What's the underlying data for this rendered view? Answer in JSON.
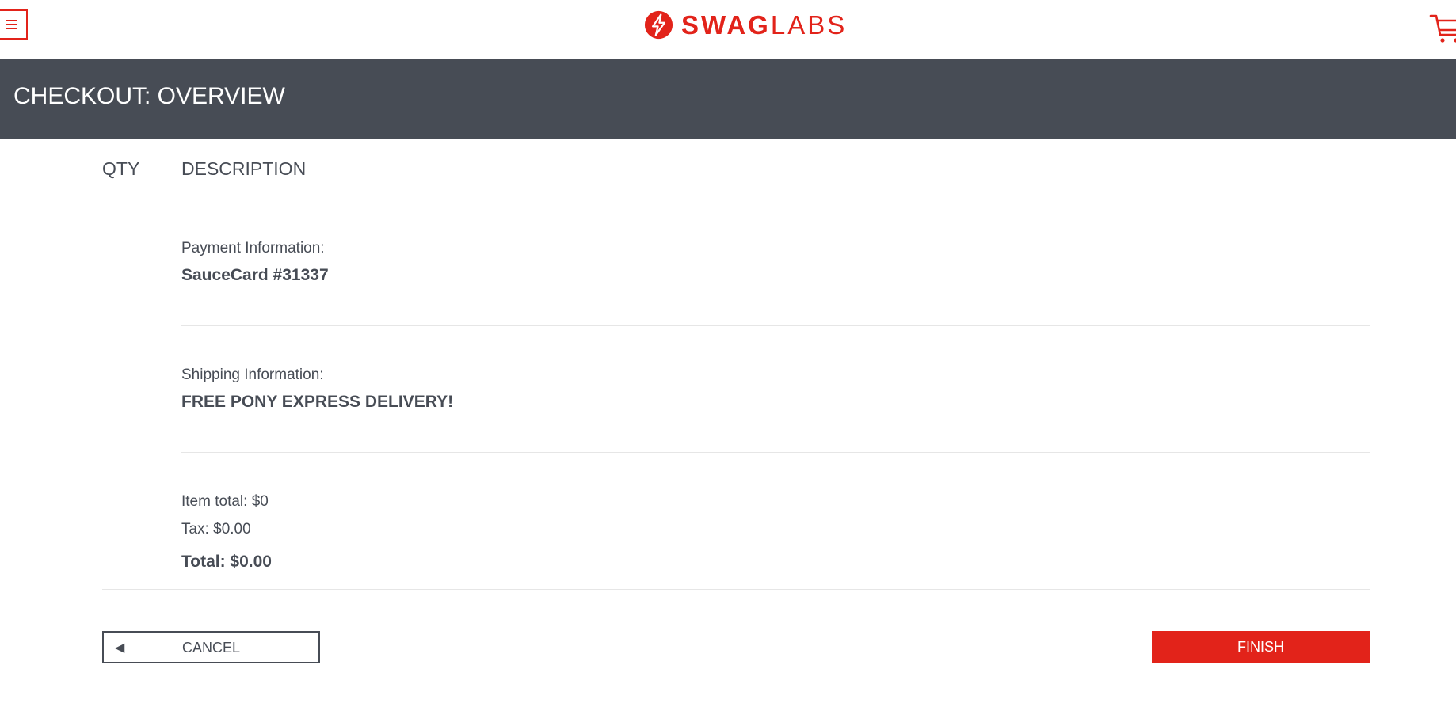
{
  "header": {
    "logo_text_strong": "SWAG",
    "logo_text_light": "LABS",
    "icons": {
      "menu": "hamburger-menu-icon",
      "logo": "swaglabs-bolt-icon",
      "cart": "shopping-cart-icon"
    }
  },
  "subheader": {
    "title": "CHECKOUT: OVERVIEW"
  },
  "columns": {
    "qty": "QTY",
    "description": "DESCRIPTION"
  },
  "summary": {
    "payment_label": "Payment Information:",
    "payment_value": "SauceCard #31337",
    "shipping_label": "Shipping Information:",
    "shipping_value": "FREE PONY EXPRESS DELIVERY!",
    "item_total": "Item total: $0",
    "tax": "Tax: $0.00",
    "total": "Total: $0.00"
  },
  "actions": {
    "cancel_label": "CANCEL",
    "cancel_icon": "left-arrow-icon",
    "finish_label": "FINISH"
  },
  "colors": {
    "brand": "#e2231a",
    "dark": "#474c55",
    "divider": "#e6e6e6"
  }
}
